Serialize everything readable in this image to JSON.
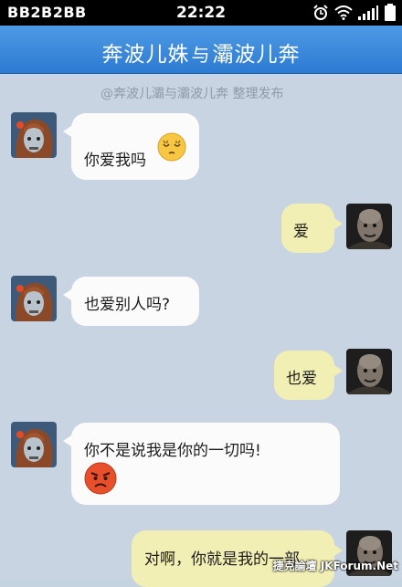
{
  "status_bar": {
    "carrier": "BB2B2BB",
    "time": "22:22",
    "icons": [
      "alarm-icon",
      "wifi-icon",
      "signal-icon",
      "battery-icon"
    ]
  },
  "nav": {
    "title_left": "奔波儿姝",
    "title_mid": "与",
    "title_right": "灞波儿奔"
  },
  "header_watermark": "@奔波儿灞与灞波儿奔 整理发布",
  "messages": [
    {
      "side": "in",
      "text": "你爱我吗",
      "emoji": "sleepy-face-emoji"
    },
    {
      "side": "out",
      "text": "爱"
    },
    {
      "side": "in",
      "text": "也爱别人吗?"
    },
    {
      "side": "out",
      "text": "也爱"
    },
    {
      "side": "in",
      "text": "你不是说我是你的一切吗!",
      "emoji": "angry-face-emoji"
    },
    {
      "side": "out",
      "text": "对啊，你就是我的一部"
    }
  ],
  "footer_watermark": "捷克論壇 JKForum.Net",
  "colors": {
    "nav_bar": "#3a86d8",
    "chat_background": "#c8d4e2",
    "incoming_bubble": "#fbfbfb",
    "outgoing_bubble": "#f2efb4"
  }
}
